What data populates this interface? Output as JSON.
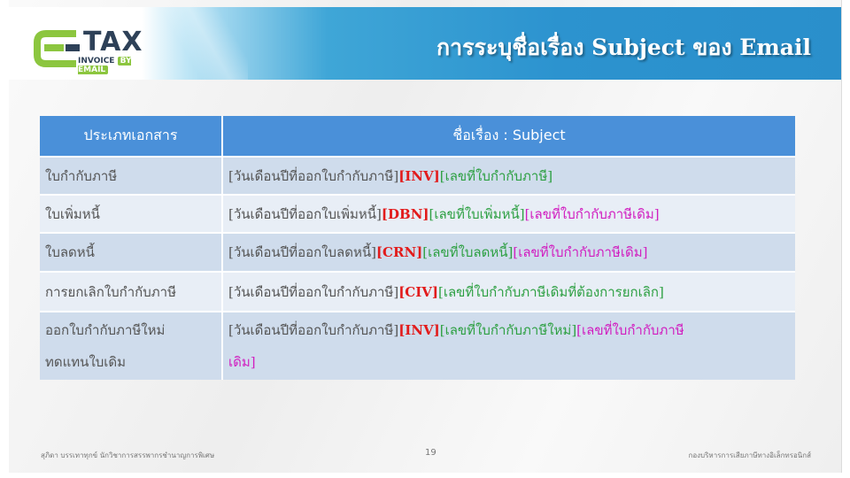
{
  "header": {
    "title": "การระบุชื่อเรื่อง Subject ของ Email",
    "logo": {
      "main": "TAX",
      "sub_left": "INVOICE",
      "sub_right": "BY EMAIL"
    }
  },
  "table": {
    "headers": [
      "ประเภทเอกสาร",
      "ชื่อเรื่อง : Subject"
    ],
    "rows": [
      {
        "type": "ใบกำกับภาษี",
        "segments": [
          {
            "text": "[วันเดือนปีที่ออกใบกำกับภาษี]",
            "color": "gray"
          },
          {
            "text": "[INV]",
            "color": "red"
          },
          {
            "text": "[เลขที่ใบกำกับภาษี]",
            "color": "green"
          }
        ]
      },
      {
        "type": "ใบเพิ่มหนี้",
        "segments": [
          {
            "text": "[วันเดือนปีที่ออกใบเพิ่มหนี้]",
            "color": "gray"
          },
          {
            "text": "[DBN]",
            "color": "red"
          },
          {
            "text": "[เลขที่ใบเพิ่มหนี้]",
            "color": "green"
          },
          {
            "text": "[เลขที่ใบกำกับภาษีเดิม]",
            "color": "magenta"
          }
        ]
      },
      {
        "type": "ใบลดหนี้",
        "segments": [
          {
            "text": "[วันเดือนปีที่ออกใบลดหนี้]",
            "color": "gray"
          },
          {
            "text": "[CRN]",
            "color": "red"
          },
          {
            "text": "[เลขที่ใบลดหนี้]",
            "color": "green"
          },
          {
            "text": "[เลขที่ใบกำกับภาษีเดิม]",
            "color": "magenta"
          }
        ]
      },
      {
        "type": "การยกเลิกใบกำกับภาษี",
        "segments": [
          {
            "text": "[วันเดือนปีที่ออกใบกำกับภาษี]",
            "color": "gray"
          },
          {
            "text": "[CIV]",
            "color": "red"
          },
          {
            "text": "[เลขที่ใบกำกับภาษีเดิมที่ต้องการยกเลิก]",
            "color": "green"
          }
        ]
      },
      {
        "type_line1": "ออกใบกำกับภาษีใหม่",
        "type_line2": "ทดแทนใบเดิม",
        "segments": [
          {
            "text": "[วันเดือนปีที่ออกใบกำกับภาษี]",
            "color": "gray"
          },
          {
            "text": "[INV]",
            "color": "red"
          },
          {
            "text": "[เลขที่ใบกำกับภาษีใหม่]",
            "color": "green"
          },
          {
            "text": "[เลขที่ใบกำกับภาษี",
            "color": "magenta"
          },
          {
            "text": "เดิม]",
            "color": "magenta"
          }
        ]
      }
    ]
  },
  "footer": {
    "left": "สุภิดา บรรเทาทุกข์   นักวิชาการสรรพากรชำนาญการพิเศษ",
    "page": "19",
    "right": "กองบริหารการเสียภาษีทางอิเล็กทรอนิกส์"
  },
  "colors": {
    "header_blue": "#2a8fcb",
    "table_header": "#4a90d9",
    "code_red": "#e21b1b",
    "number_green": "#2ea043",
    "original_magenta": "#d11ec0"
  }
}
